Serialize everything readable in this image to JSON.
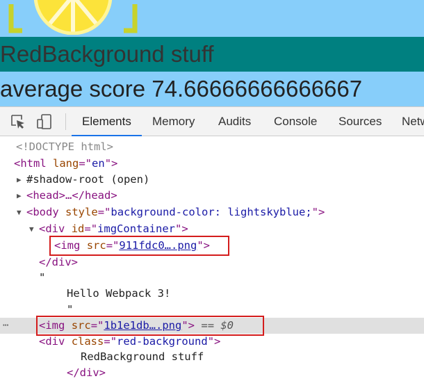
{
  "page": {
    "red_background_text": "RedBackground stuff",
    "score_text": "average score 74.66666666666667"
  },
  "devtools": {
    "tools": {
      "inspect_icon": "inspect-icon",
      "device_icon": "device-toolbar-icon"
    },
    "tabs": [
      {
        "label": "Elements",
        "active": true
      },
      {
        "label": "Memory"
      },
      {
        "label": "Audits"
      },
      {
        "label": "Console"
      },
      {
        "label": "Sources"
      },
      {
        "label": "Netw"
      }
    ],
    "tree": {
      "doctype": "<!DOCTYPE html>",
      "html_tag": "html",
      "lang_attr": "lang",
      "lang_val": "en",
      "shadow_root": "#shadow-root (open)",
      "head_text": "<head>…</head>",
      "body_tag": "body",
      "body_attr": "style",
      "body_style": "background-color: lightskyblue;",
      "div_tag": "div",
      "id_attr": "id",
      "div_id": "imgContainer",
      "img_tag": "img",
      "src_attr": "src",
      "img1_src": "911fdc0….png",
      "div_close": "</div>",
      "quote": "\"",
      "hello_text": "Hello Webpack 3!",
      "img2_src": "1b1e1db….png",
      "selected_marker": "== $0",
      "ellipsis": "⋯",
      "class_attr": "class",
      "div_class": "red-background",
      "red_text": "RedBackground stuff",
      "div_close2": "</div>"
    }
  },
  "colors": {
    "sky": "#87cefa",
    "teal": "#008080",
    "highlight": "#d41c1c",
    "tab_underline": "#1a73e8"
  }
}
